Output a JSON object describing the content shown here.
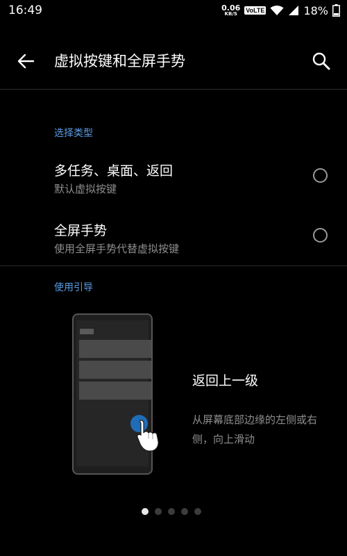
{
  "status_bar": {
    "time": "16:49",
    "net_speed_value": "0.06",
    "net_speed_unit": "KB/S",
    "volte": "VoLTE",
    "battery": "18%"
  },
  "header": {
    "title": "虚拟按键和全屏手势",
    "back_icon": "back-arrow-icon",
    "search_icon": "search-icon"
  },
  "select_type": {
    "label": "选择类型",
    "options": [
      {
        "title": "多任务、桌面、返回",
        "subtitle": "默认虚拟按键",
        "selected": false
      },
      {
        "title": "全屏手势",
        "subtitle": "使用全屏手势代替虚拟按键",
        "selected": false
      }
    ]
  },
  "guide": {
    "label": "使用引导",
    "title": "返回上一级",
    "description": "从屏幕底部边缘的左侧或右侧，向上滑动",
    "page_count": 5,
    "current_page": 1
  },
  "colors": {
    "background": "#000000",
    "accent": "#5c9ce6",
    "touch_indicator": "#1f6db8",
    "secondary_text": "#8e8e8e"
  }
}
